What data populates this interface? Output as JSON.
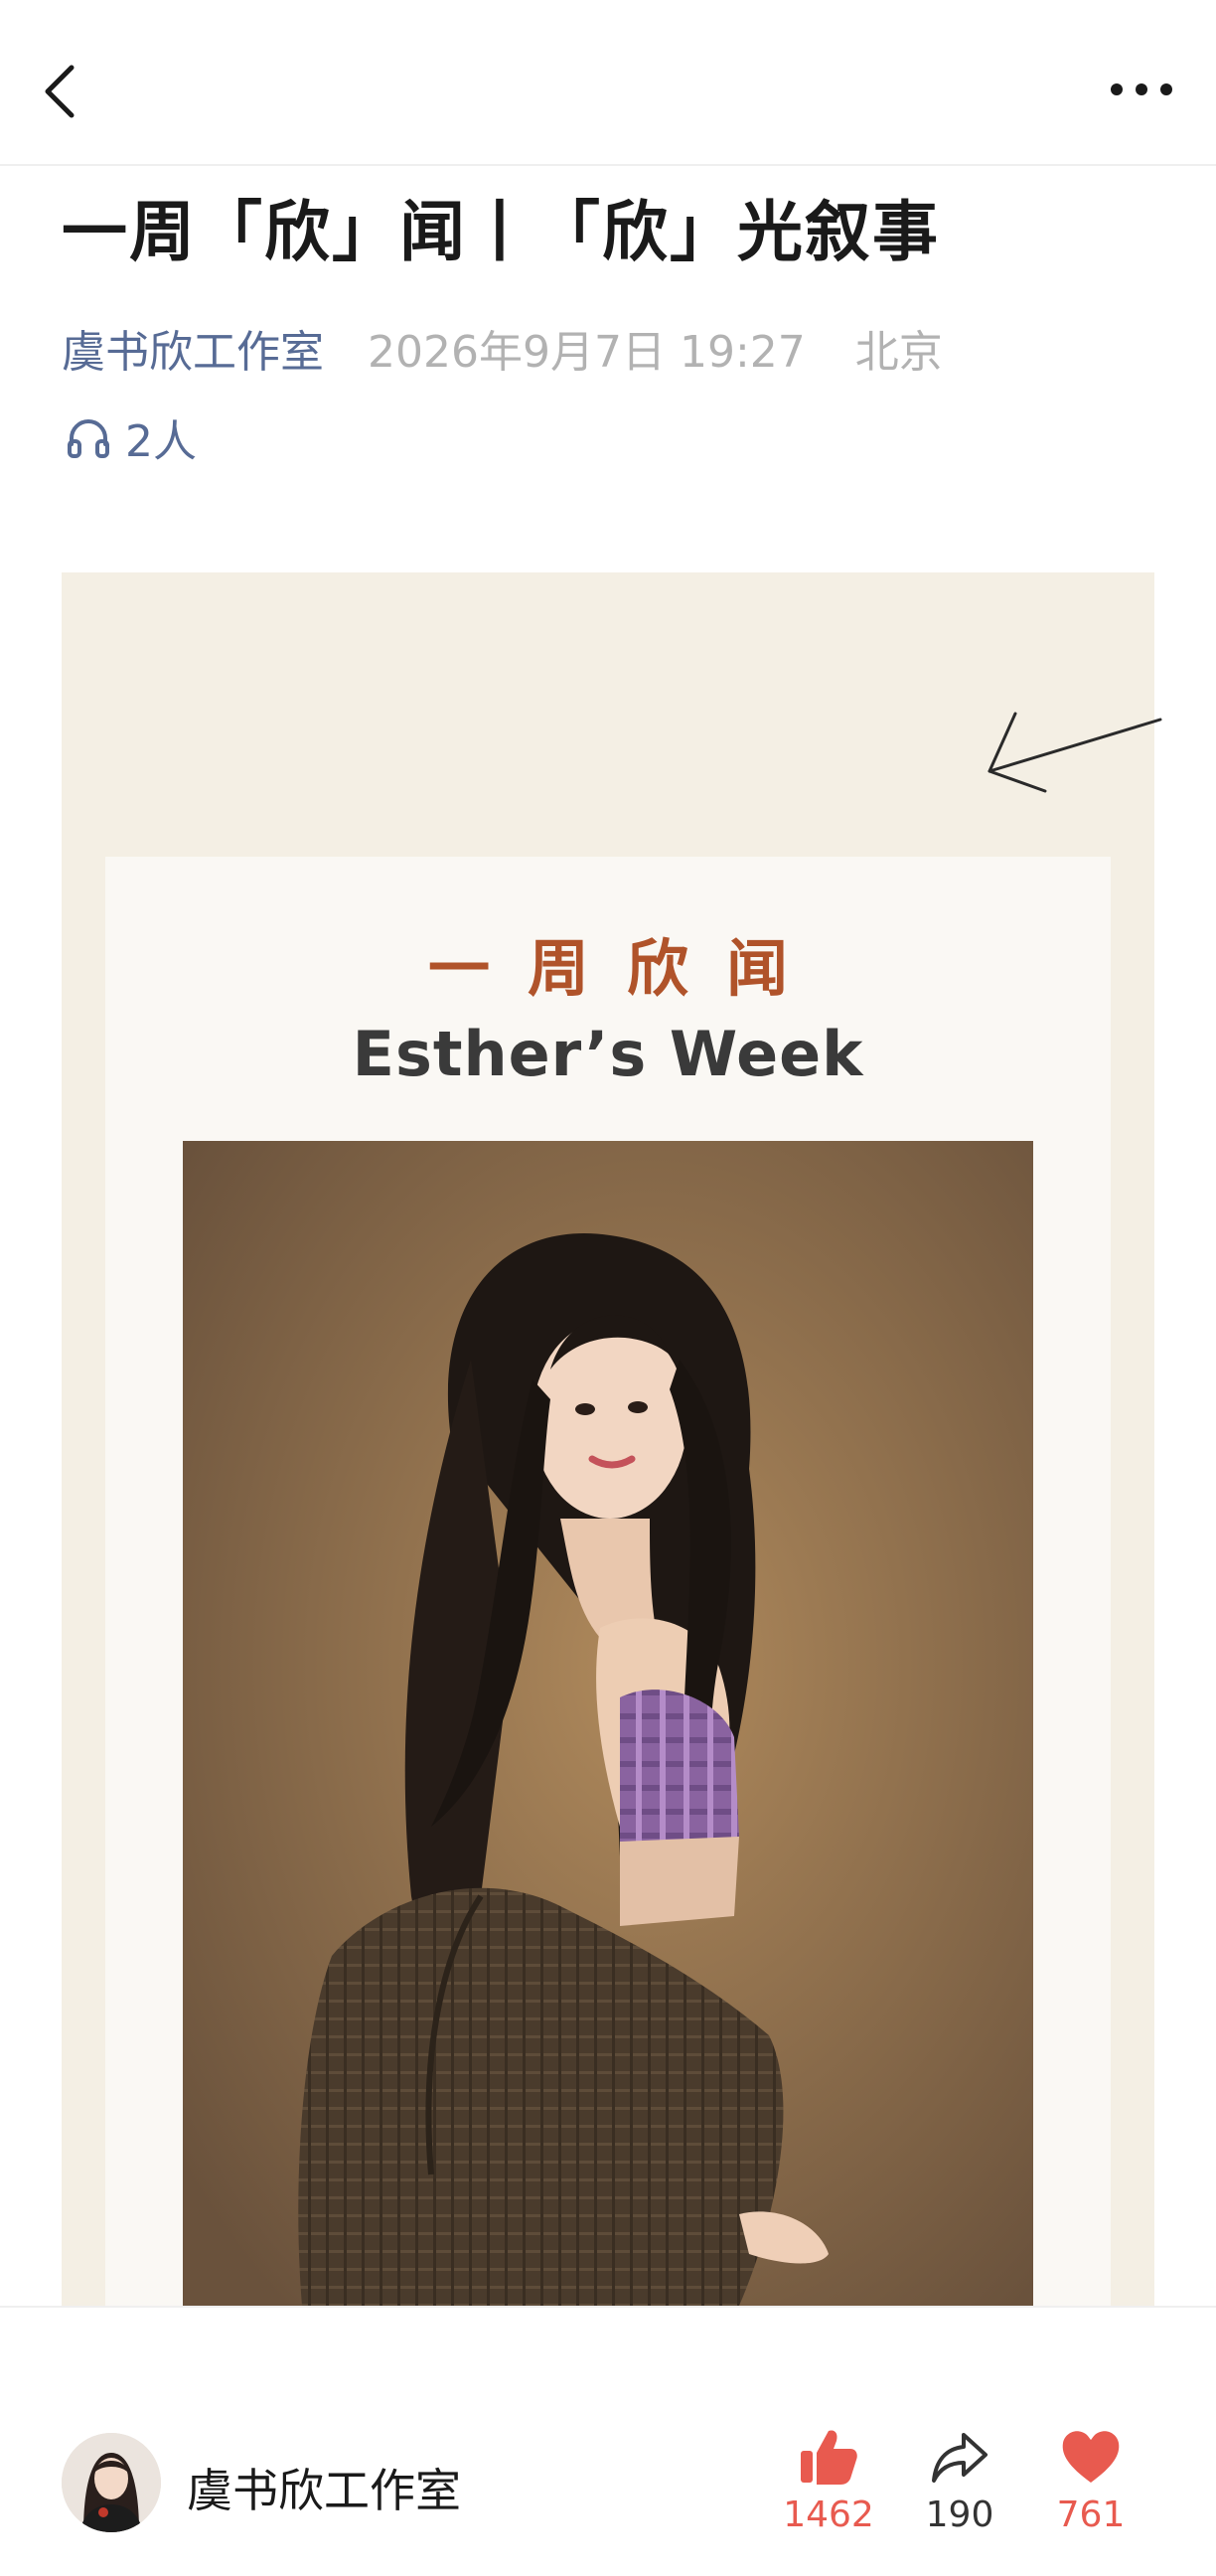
{
  "header": {
    "title": "一周「欣」闻丨「欣」光叙事",
    "author": "虞书欣工作室",
    "date": "2026年9月7日 19:27",
    "location": "北京",
    "listeners": "2人"
  },
  "card": {
    "zh_title": "一周欣闻",
    "en_title": "Esther’s Week"
  },
  "bottom_bar": {
    "author": "虞书欣工作室",
    "like_count": "1462",
    "share_count": "190",
    "favorite_count": "761"
  },
  "icons": {
    "back": "chevron-left-icon",
    "more": "more-dots-icon",
    "headphones": "headphones-icon",
    "arrow": "arrow-icon",
    "like": "thumbs-up-icon",
    "share": "share-icon",
    "favorite": "heart-icon"
  },
  "colors": {
    "link": "#576b95",
    "accent_orange": "#b0532a",
    "like_red": "#e85a4f",
    "card_bg": "#f4efe4"
  }
}
